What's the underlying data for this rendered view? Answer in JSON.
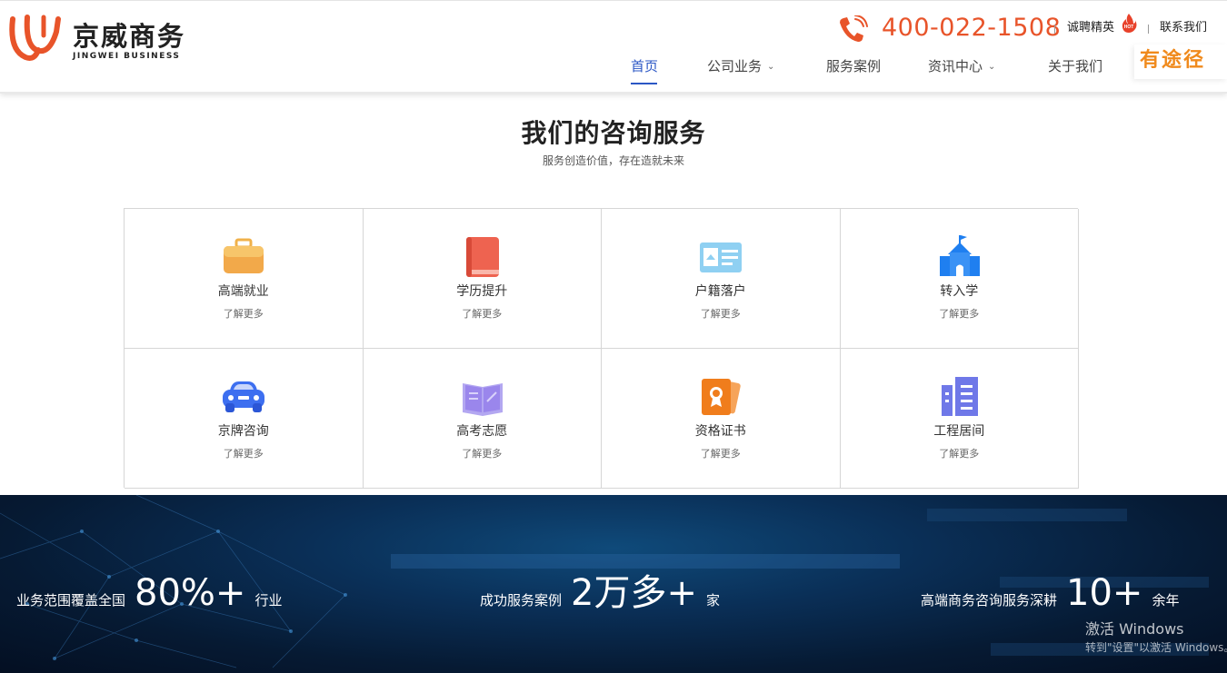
{
  "header": {
    "logo_cn": "京威商务",
    "logo_en": "JINGWEI BUSINESS",
    "phone": "400-022-1508",
    "recruit": "诚聘精英",
    "hot_badge": "HOT",
    "contact": "联系我们",
    "brand_badge": "有途径",
    "accent_color": "#e8542a"
  },
  "nav": [
    {
      "label": "首页",
      "active": true,
      "dropdown": false
    },
    {
      "label": "公司业务",
      "active": false,
      "dropdown": true
    },
    {
      "label": "服务案例",
      "active": false,
      "dropdown": false
    },
    {
      "label": "资讯中心",
      "active": false,
      "dropdown": true
    },
    {
      "label": "关于我们",
      "active": false,
      "dropdown": false
    }
  ],
  "services": {
    "title": "我们的咨询服务",
    "subtitle": "服务创造价值，存在造就未来",
    "more_label": "了解更多",
    "items": [
      {
        "label": "高端就业",
        "icon": "briefcase-icon",
        "color": "#f0b14a"
      },
      {
        "label": "学历提升",
        "icon": "book-icon",
        "color": "#ee6350"
      },
      {
        "label": "户籍落户",
        "icon": "id-card-icon",
        "color": "#8fd0f2"
      },
      {
        "label": "转入学",
        "icon": "school-icon",
        "color": "#1f7ff0"
      },
      {
        "label": "京牌咨询",
        "icon": "car-icon",
        "color": "#3d6ff0"
      },
      {
        "label": "高考志愿",
        "icon": "open-book-icon",
        "color": "#9a86ec"
      },
      {
        "label": "资格证书",
        "icon": "certificate-icon",
        "color": "#f07d1c"
      },
      {
        "label": "工程居间",
        "icon": "building-icon",
        "color": "#6f78e8"
      }
    ]
  },
  "stats": [
    {
      "label": "业务范围覆盖全国",
      "value": "80%+",
      "unit": "行业"
    },
    {
      "label": "成功服务案例",
      "value": "2万多+",
      "unit": "家"
    },
    {
      "label": "高端商务咨询服务深耕",
      "value": "10+",
      "unit": "余年"
    }
  ],
  "watermark": {
    "title": "激活 Windows",
    "subtitle": "转到\"设置\"以激活 Windows。"
  }
}
